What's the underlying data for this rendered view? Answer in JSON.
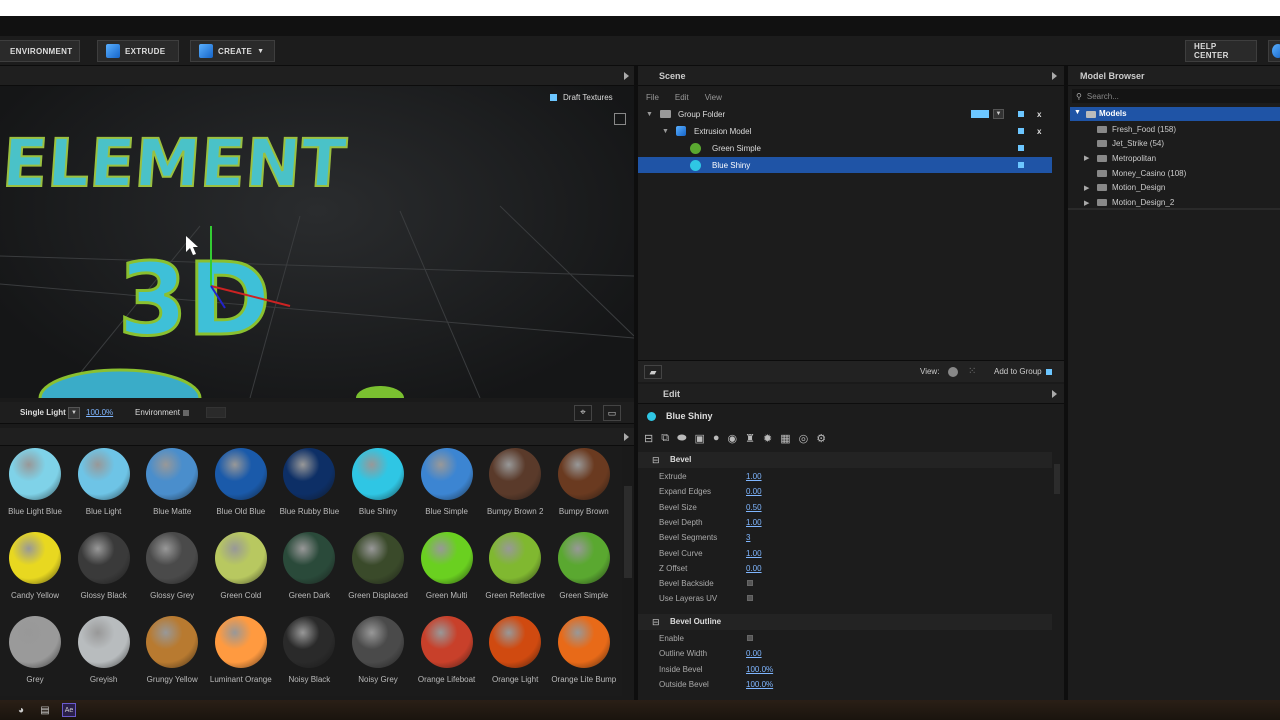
{
  "toolbar": {
    "environment": "ENVIRONMENT",
    "extrude": "EXTRUDE",
    "create": "CREATE",
    "help": "HELP CENTER"
  },
  "viewport": {
    "draft_textures": "Draft Textures",
    "single_light": "Single Light",
    "zoom": "100.0%",
    "environment": "Environment",
    "text1": "ELEMENT",
    "text2": "3D"
  },
  "materials": [
    {
      "name": "Blue Light Blue",
      "color": "#7fd2e8"
    },
    {
      "name": "Blue Light",
      "color": "#6ec4e6"
    },
    {
      "name": "Blue Matte",
      "color": "#4a8ecc"
    },
    {
      "name": "Blue Old Blue",
      "color": "#1a5aaa"
    },
    {
      "name": "Blue Rubby Blue",
      "color": "#0d2f66"
    },
    {
      "name": "Blue Shiny",
      "color": "#2fc6e4"
    },
    {
      "name": "Blue Simple",
      "color": "#3c85d2"
    },
    {
      "name": "Bumpy Brown 2",
      "color": "#5a3a2a"
    },
    {
      "name": "Bumpy Brown",
      "color": "#6a3a20"
    },
    {
      "name": "Candy Yellow",
      "color": "#e8d820"
    },
    {
      "name": "Glossy Black",
      "color": "#3a3a3a"
    },
    {
      "name": "Glossy Grey",
      "color": "#4a4a4a"
    },
    {
      "name": "Green Cold",
      "color": "#b8c860"
    },
    {
      "name": "Green Dark",
      "color": "#2a4a3a"
    },
    {
      "name": "Green Displaced",
      "color": "#3a4a2a"
    },
    {
      "name": "Green Multi",
      "color": "#6ad020"
    },
    {
      "name": "Green Reflective",
      "color": "#80b830"
    },
    {
      "name": "Green Simple",
      "color": "#5aa830"
    },
    {
      "name": "Grey",
      "color": "#9a9a9a"
    },
    {
      "name": "Greyish",
      "color": "#b8bcbe"
    },
    {
      "name": "Grungy Yellow",
      "color": "#b87a30"
    },
    {
      "name": "Luminant Orange",
      "color": "#ff9a40"
    },
    {
      "name": "Noisy Black",
      "color": "#2a2a2a"
    },
    {
      "name": "Noisy Grey",
      "color": "#4a4a4a"
    },
    {
      "name": "Orange Lifeboat",
      "color": "#c8402a"
    },
    {
      "name": "Orange Light",
      "color": "#d04a10"
    },
    {
      "name": "Orange Lite Bump",
      "color": "#e86a18"
    }
  ],
  "scene": {
    "title": "Scene",
    "menu_file": "File",
    "menu_edit": "Edit",
    "menu_view": "View",
    "items": [
      "Group Folder",
      "Extrusion Model",
      "Green Simple",
      "Blue Shiny"
    ],
    "view_label": "View:",
    "add_to_group": "Add to Group"
  },
  "edit": {
    "title": "Edit",
    "material": "Blue Shiny",
    "section_bevel": "Bevel",
    "section_outline": "Bevel Outline",
    "bevel_props": [
      {
        "label": "Extrude",
        "value": "1.00"
      },
      {
        "label": "Expand Edges",
        "value": "0.00"
      },
      {
        "label": "Bevel Size",
        "value": "0.50"
      },
      {
        "label": "Bevel Depth",
        "value": "1.00"
      },
      {
        "label": "Bevel Segments",
        "value": "3"
      },
      {
        "label": "Bevel Curve",
        "value": "1.00"
      },
      {
        "label": "Z Offset",
        "value": "0.00"
      },
      {
        "label": "Bevel Backside",
        "value": ""
      },
      {
        "label": "Use Layeras UV",
        "value": ""
      }
    ],
    "outline_props": [
      {
        "label": "Enable",
        "value": ""
      },
      {
        "label": "Outline Width",
        "value": "0.00"
      },
      {
        "label": "Inside Bevel",
        "value": "100.0%"
      },
      {
        "label": "Outside Bevel",
        "value": "100.0%"
      }
    ]
  },
  "browser": {
    "title": "Model Browser",
    "search_placeholder": "Search...",
    "items": [
      "Models",
      "Fresh_Food (158)",
      "Jet_Strike (54)",
      "Metropolitan",
      "Money_Casino (108)",
      "Motion_Design",
      "Motion_Design_2"
    ]
  }
}
